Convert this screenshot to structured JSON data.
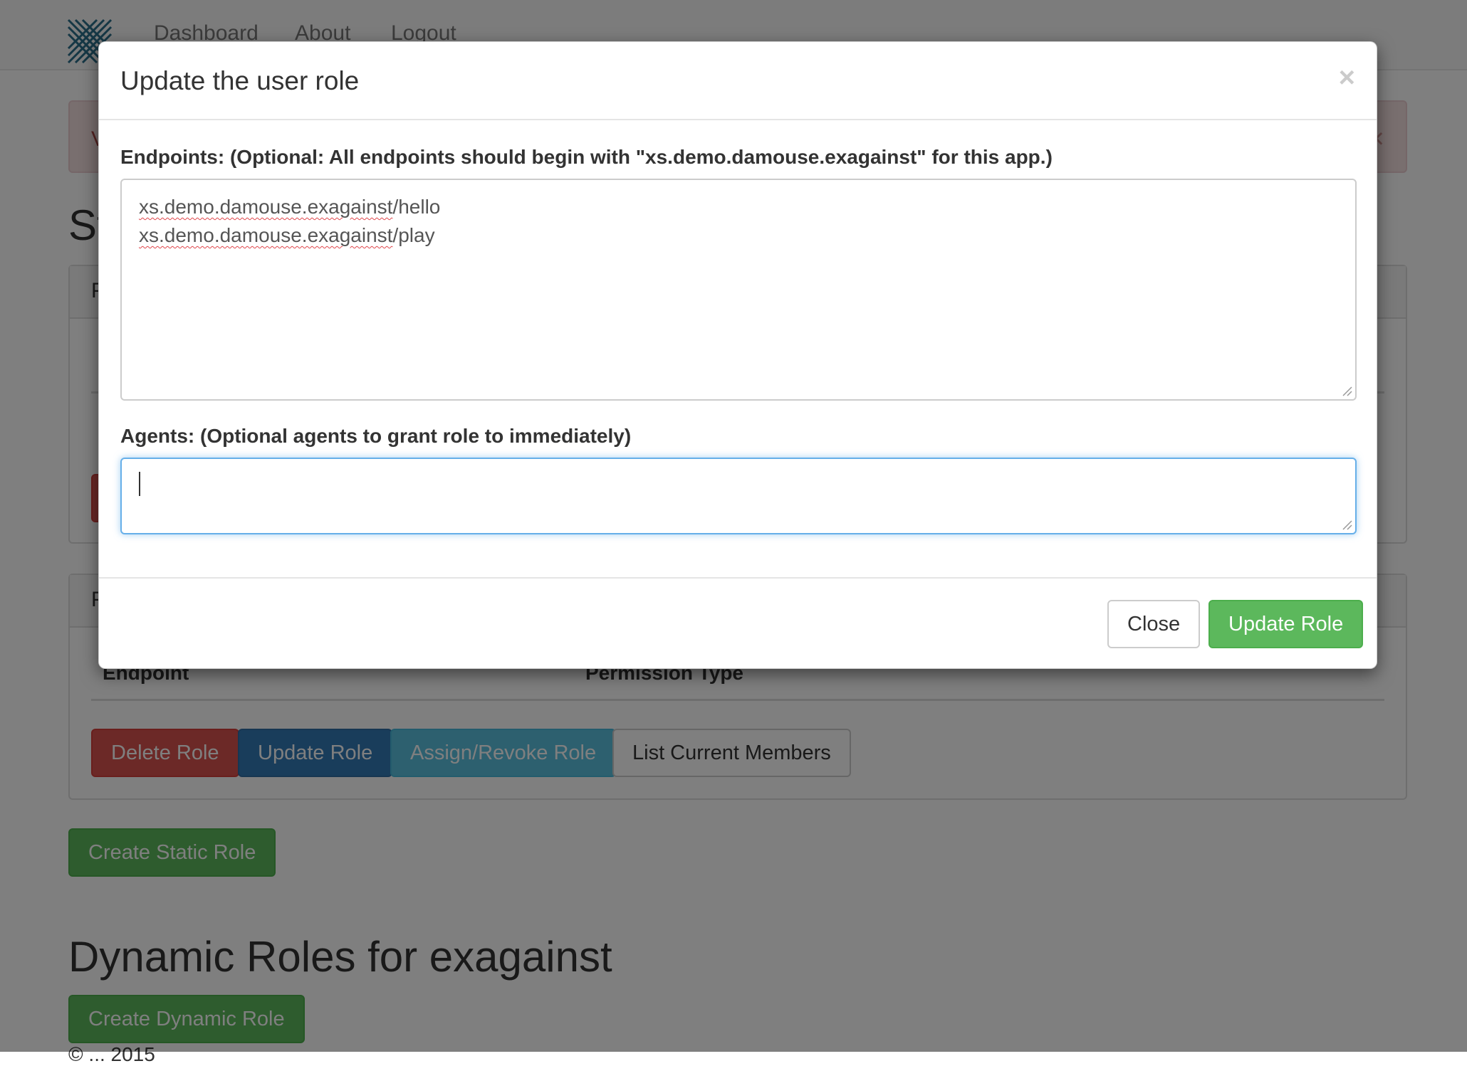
{
  "nav": {
    "brand_icon": "crosshatch-logo-icon",
    "links": [
      "Dashboard",
      "About",
      "Logout"
    ]
  },
  "background": {
    "alert_text": "V",
    "static_heading": "St",
    "panel1_heading": "P",
    "panel2_heading": "P",
    "table_headers": [
      "Endpoint",
      "Permission Type"
    ],
    "buttons": {
      "delete": "Delete Role",
      "update": "Update Role",
      "assign": "Assign/Revoke Role",
      "list": "List Current Members"
    },
    "create_static": "Create Static Role",
    "dynamic_heading": "Dynamic Roles for exagainst",
    "create_dynamic": "Create Dynamic Role",
    "footer": "© ... 2015"
  },
  "modal": {
    "title": "Update the user role",
    "close_icon": "×",
    "endpoints_label": "Endpoints: (Optional: All endpoints should begin with \"xs.demo.damouse.exagainst\" for this app.)",
    "endpoints": [
      {
        "prefix": "xs.demo.damouse.exagainst",
        "suffix": "/hello"
      },
      {
        "prefix": "xs.demo.damouse.exagainst",
        "suffix": "/play"
      }
    ],
    "agents_label": "Agents: (Optional agents to grant role to immediately)",
    "agents_value": "",
    "close_button": "Close",
    "update_button": "Update Role"
  },
  "colors": {
    "success": "#5cb85c",
    "danger": "#d9534f",
    "primary": "#337ab7",
    "info": "#5bc0de",
    "focus": "#66afe9"
  }
}
